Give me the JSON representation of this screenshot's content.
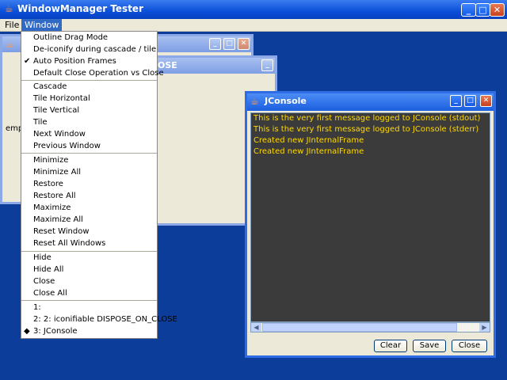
{
  "app": {
    "title": "WindowManager Tester"
  },
  "menubar": {
    "file": "File",
    "window": "Window"
  },
  "frames": {
    "frame1_title": "",
    "frame2_title_fragment": "OSE",
    "frame1_text": "empt",
    "console_title": "JConsole"
  },
  "console": {
    "lines": [
      "This is the very first message logged to JConsole (stdout)",
      "This is the very first message logged to JConsole (stderr)",
      "Created new JInternalFrame",
      "Created new JInternalFrame"
    ],
    "buttons": {
      "clear": "Clear",
      "save": "Save",
      "close": "Close"
    }
  },
  "window_menu": {
    "items": [
      "Outline Drag Mode",
      "De-iconify during cascade / tile",
      "Auto Position Frames",
      "Default Close Operation vs Close",
      "Cascade",
      "Tile Horizontal",
      "Tile Vertical",
      "Tile",
      "Next Window",
      "Previous Window",
      "Minimize",
      "Minimize All",
      "Restore",
      "Restore All",
      "Maximize",
      "Maximize All",
      "Reset Window",
      "Reset All Windows",
      "Hide",
      "Hide All",
      "Close",
      "Close All",
      "1:",
      "2: 2: iconifiable DISPOSE_ON_CLOSE",
      "3: JConsole"
    ],
    "checked_item": "Auto Position Frames",
    "selected_window": "3: JConsole"
  },
  "icons": {
    "checkmark": "✔",
    "radio_dot": "◆",
    "minimize": "_",
    "maximize": "□",
    "close": "✕",
    "app": "java-cup-icon"
  }
}
